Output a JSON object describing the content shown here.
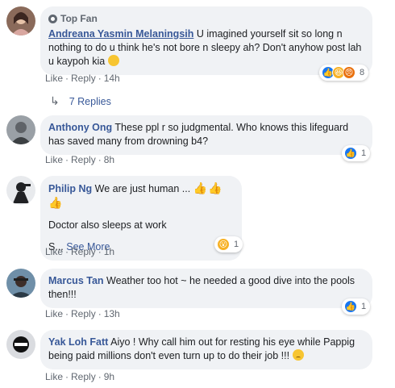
{
  "comments": [
    {
      "author": "Andreana Yasmin Melaningsih",
      "badge": "Top Fan",
      "text": "U imagined yourself sit so long n nothing to do u think he's not bore n sleepy ah? Don't anyhow post lah u kaypoh kia",
      "like": "Like",
      "reply": "Reply",
      "time": "14h",
      "reactions": [
        "like-icon",
        "haha-icon",
        "angry-icon"
      ],
      "reaction_count": "8",
      "replies": "7 Replies"
    },
    {
      "author": "Anthony Ong",
      "text": "These ppl r so judgmental. Who knows this lifeguard has saved many from drowning b4?",
      "like": "Like",
      "reply": "Reply",
      "time": "8h",
      "reactions": [
        "like-icon"
      ],
      "reaction_count": "1"
    },
    {
      "author": "Philip Ng",
      "text": "We are just human ...",
      "text2": "Doctor also sleeps at work",
      "text3": "S...",
      "see_more": "See More",
      "like": "Like",
      "reply": "Reply",
      "time": "1h",
      "reactions": [
        "wow-icon"
      ],
      "reaction_count": "1"
    },
    {
      "author": "Marcus Tan",
      "text": "Weather too hot ~ he needed a good dive into the pools then!!!",
      "like": "Like",
      "reply": "Reply",
      "time": "13h",
      "reactions": [
        "like-icon"
      ],
      "reaction_count": "1"
    },
    {
      "author": "Yak Loh Fatt",
      "text": "Aiyo ! Why call him out for resting his eye while Pappig being paid millions don't even turn up to do their job !!!",
      "like": "Like",
      "reply": "Reply",
      "time": "9h"
    }
  ],
  "separator": "·",
  "colors": {
    "link": "#385898",
    "bubble": "#f0f2f5",
    "meta": "#606770",
    "like": "#1877f2"
  }
}
